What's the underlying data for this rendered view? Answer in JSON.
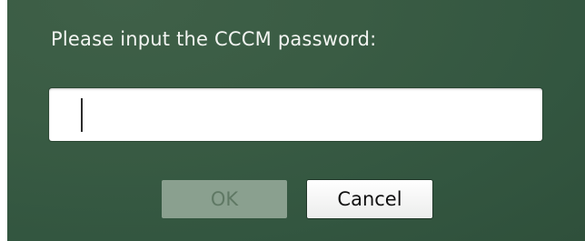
{
  "dialog": {
    "prompt": "Please input the CCCM password:",
    "password_value": "",
    "ok_label": "OK",
    "cancel_label": "Cancel",
    "ok_enabled": false
  },
  "colors": {
    "background": "#3a5c44",
    "prompt_text": "#f2f4f1",
    "ok_disabled_bg": "#8aa08f",
    "ok_disabled_text": "#5f7864",
    "cancel_bg": "#ffffff"
  }
}
